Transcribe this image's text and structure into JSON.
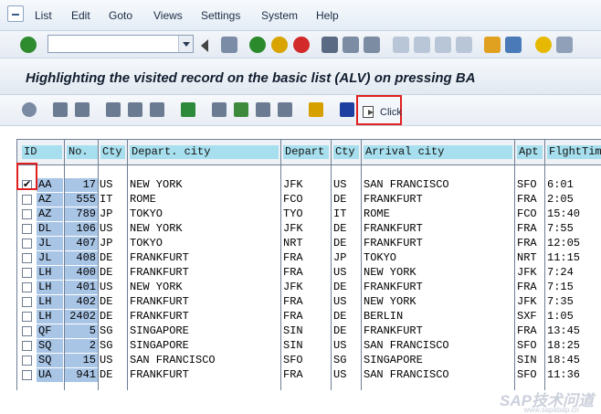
{
  "menu": [
    "List",
    "Edit",
    "Goto",
    "Views",
    "Settings",
    "System",
    "Help"
  ],
  "command_field": {
    "value": "",
    "placeholder": ""
  },
  "title": "Highlighting the visited record on the basic list (ALV) on pressing BA",
  "app_toolbar": {
    "click_label": "Click"
  },
  "columns": [
    "ID",
    "No.",
    "Cty",
    "Depart. city",
    "Depart",
    "Cty",
    "Arrival city",
    "Apt",
    "FlghtTim"
  ],
  "rows": [
    {
      "id": "AA",
      "no": "17",
      "cty1": "US",
      "depcity": "NEW YORK",
      "dep": "JFK",
      "cty2": "US",
      "arrcity": "SAN FRANCISCO",
      "apt": "SFO",
      "time": "6:01",
      "checked": true
    },
    {
      "id": "AZ",
      "no": "555",
      "cty1": "IT",
      "depcity": "ROME",
      "dep": "FCO",
      "cty2": "DE",
      "arrcity": "FRANKFURT",
      "apt": "FRA",
      "time": "2:05",
      "checked": false
    },
    {
      "id": "AZ",
      "no": "789",
      "cty1": "JP",
      "depcity": "TOKYO",
      "dep": "TYO",
      "cty2": "IT",
      "arrcity": "ROME",
      "apt": "FCO",
      "time": "15:40",
      "checked": false
    },
    {
      "id": "DL",
      "no": "106",
      "cty1": "US",
      "depcity": "NEW YORK",
      "dep": "JFK",
      "cty2": "DE",
      "arrcity": "FRANKFURT",
      "apt": "FRA",
      "time": "7:55",
      "checked": false
    },
    {
      "id": "JL",
      "no": "407",
      "cty1": "JP",
      "depcity": "TOKYO",
      "dep": "NRT",
      "cty2": "DE",
      "arrcity": "FRANKFURT",
      "apt": "FRA",
      "time": "12:05",
      "checked": false
    },
    {
      "id": "JL",
      "no": "408",
      "cty1": "DE",
      "depcity": "FRANKFURT",
      "dep": "FRA",
      "cty2": "JP",
      "arrcity": "TOKYO",
      "apt": "NRT",
      "time": "11:15",
      "checked": false
    },
    {
      "id": "LH",
      "no": "400",
      "cty1": "DE",
      "depcity": "FRANKFURT",
      "dep": "FRA",
      "cty2": "US",
      "arrcity": "NEW YORK",
      "apt": "JFK",
      "time": "7:24",
      "checked": false
    },
    {
      "id": "LH",
      "no": "401",
      "cty1": "US",
      "depcity": "NEW YORK",
      "dep": "JFK",
      "cty2": "DE",
      "arrcity": "FRANKFURT",
      "apt": "FRA",
      "time": "7:15",
      "checked": false
    },
    {
      "id": "LH",
      "no": "402",
      "cty1": "DE",
      "depcity": "FRANKFURT",
      "dep": "FRA",
      "cty2": "US",
      "arrcity": "NEW YORK",
      "apt": "JFK",
      "time": "7:35",
      "checked": false
    },
    {
      "id": "LH",
      "no": "2402",
      "cty1": "DE",
      "depcity": "FRANKFURT",
      "dep": "FRA",
      "cty2": "DE",
      "arrcity": "BERLIN",
      "apt": "SXF",
      "time": "1:05",
      "checked": false
    },
    {
      "id": "QF",
      "no": "5",
      "cty1": "SG",
      "depcity": "SINGAPORE",
      "dep": "SIN",
      "cty2": "DE",
      "arrcity": "FRANKFURT",
      "apt": "FRA",
      "time": "13:45",
      "checked": false
    },
    {
      "id": "SQ",
      "no": "2",
      "cty1": "SG",
      "depcity": "SINGAPORE",
      "dep": "SIN",
      "cty2": "US",
      "arrcity": "SAN FRANCISCO",
      "apt": "SFO",
      "time": "18:25",
      "checked": false
    },
    {
      "id": "SQ",
      "no": "15",
      "cty1": "US",
      "depcity": "SAN FRANCISCO",
      "dep": "SFO",
      "cty2": "SG",
      "arrcity": "SINGAPORE",
      "apt": "SIN",
      "time": "18:45",
      "checked": false
    },
    {
      "id": "UA",
      "no": "941",
      "cty1": "DE",
      "depcity": "FRANKFURT",
      "dep": "FRA",
      "cty2": "US",
      "arrcity": "SAN FRANCISCO",
      "apt": "SFO",
      "time": "11:36",
      "checked": false
    }
  ],
  "watermark": "SAP技术问道",
  "watermark_sub": "www.sapabap.cn"
}
